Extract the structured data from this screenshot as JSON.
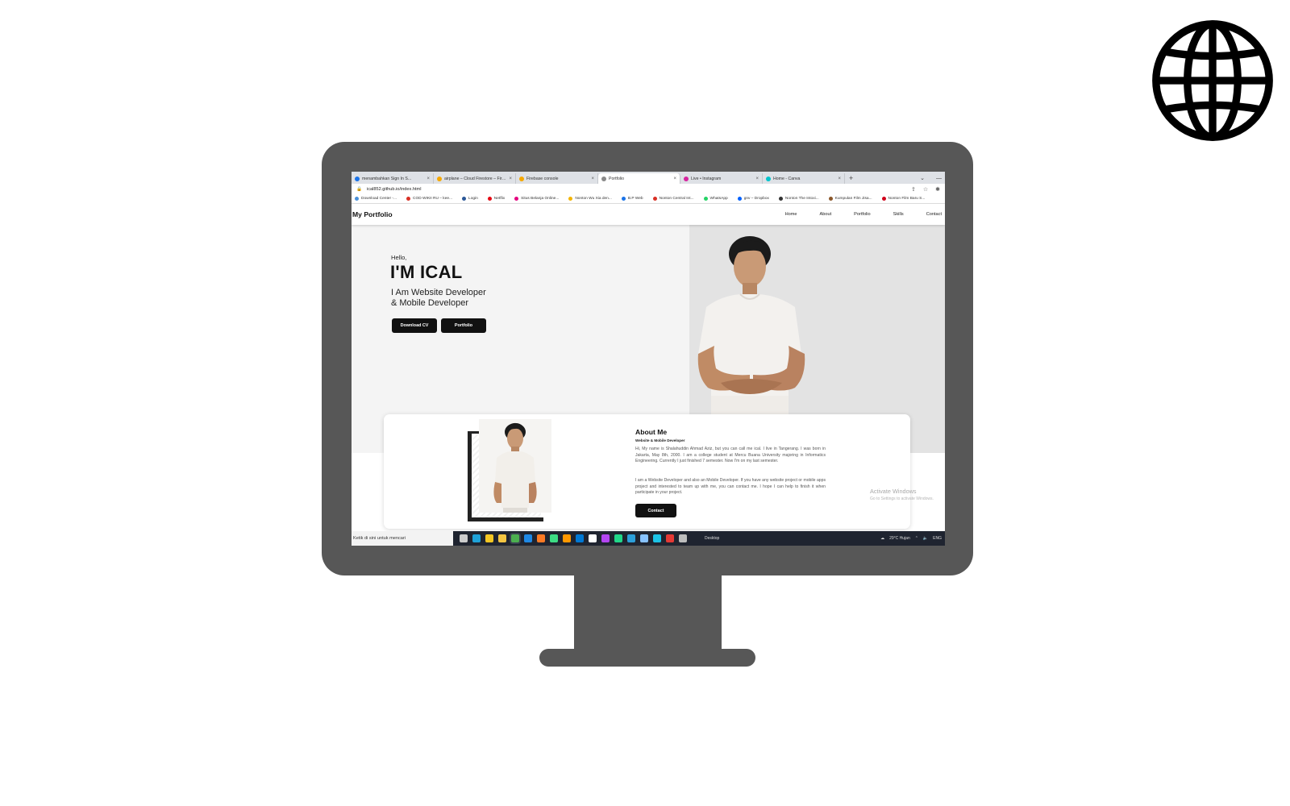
{
  "browser": {
    "tabs": [
      {
        "label": "menambahkan Sign In S...",
        "color": "#1a73e8",
        "active": false
      },
      {
        "label": "airplane – Cloud Firestore – Fire...",
        "color": "#f6a800",
        "active": false
      },
      {
        "label": "Firebase console",
        "color": "#f6a800",
        "active": false
      },
      {
        "label": "Portfolio",
        "color": "#8a8a8a",
        "active": true
      },
      {
        "label": "Live • Instagram",
        "color": "#d6249f",
        "active": false
      },
      {
        "label": "Home - Canva",
        "color": "#00c4cc",
        "active": false
      }
    ],
    "new_tab": "+",
    "url": "ical852.github.io/index.html",
    "bookmarks": [
      {
        "label": "Download Center -...",
        "color": "#4a90d9"
      },
      {
        "label": "COD WIKII RU – kee...",
        "color": "#d93025"
      },
      {
        "label": "Login",
        "color": "#2b5797"
      },
      {
        "label": "Netflix",
        "color": "#e50914"
      },
      {
        "label": "Situs Belanja Online...",
        "color": "#e4007f"
      },
      {
        "label": "Nonton Wu Xia den...",
        "color": "#f4b400"
      },
      {
        "label": "B.P Web",
        "color": "#1a73e8"
      },
      {
        "label": "Nonton Central Int...",
        "color": "#d93025"
      },
      {
        "label": "WhatsApp",
        "color": "#25d366"
      },
      {
        "label": "gnv – Dropbox",
        "color": "#0061fe"
      },
      {
        "label": "Nonton The Intoxi...",
        "color": "#333333"
      },
      {
        "label": "Kumpulan Film Jisa...",
        "color": "#8b572a"
      },
      {
        "label": "Nonton Film Baru S...",
        "color": "#d0021b"
      }
    ]
  },
  "site": {
    "brand": "My Portfolio",
    "nav": [
      "Home",
      "About",
      "Portfolio",
      "Skills",
      "Contact"
    ],
    "hero": {
      "hello": "Hello,",
      "name": "I'M ICAL",
      "role_line1": "I Am Website Developer",
      "role_line2": "& Mobile Developer",
      "btn_cv": "Download CV",
      "btn_portfolio": "Portfolio"
    },
    "about": {
      "title": "About Me",
      "subtitle": "Website & Mobile Developer",
      "p1": "Hi, My name is Shalahuddin Ahmad Aziz, but you can call me ical. I live in Tangerang. I was born in Jakarta, May 8th, 2000. I am a college student at Mercu Buana University majoring in Informatics Engineering. Currently I just finished 7 semester. Now I'm on my last semester.",
      "p2": "I am a Website Developer and also an Mobile Developer. If you have any website project or mobile apps project and interested to team up with me, you can contact me. I hope I can help to finish it when participate in your project.",
      "btn_contact": "Contact"
    }
  },
  "os": {
    "activate_title": "Activate Windows",
    "activate_sub": "Go to Settings to activate Windows.",
    "search_placeholder": "Ketik di sini untuk mencari",
    "desktop_label": "Desktop",
    "weather": "29°C  Hujan",
    "lang": "ENG",
    "taskbar_icons": [
      {
        "name": "task-view-icon",
        "color": "#cccccc"
      },
      {
        "name": "edge-icon",
        "color": "#1fa2d8"
      },
      {
        "name": "store-icon",
        "color": "#f3c623"
      },
      {
        "name": "file-explorer-icon",
        "color": "#f4c542"
      },
      {
        "name": "chrome-icon",
        "color": "#4caf50"
      },
      {
        "name": "mail-icon",
        "color": "#1e88e5"
      },
      {
        "name": "xampp-icon",
        "color": "#fb7a24"
      },
      {
        "name": "android-studio-icon",
        "color": "#3ddc84"
      },
      {
        "name": "sublime-icon",
        "color": "#ff9800"
      },
      {
        "name": "vscode-icon",
        "color": "#0078d4"
      },
      {
        "name": "app-icon",
        "color": "#ffffff"
      },
      {
        "name": "phpstorm-icon",
        "color": "#b345f1"
      },
      {
        "name": "app2-icon",
        "color": "#21d789"
      },
      {
        "name": "app3-icon",
        "color": "#2c9fd9"
      },
      {
        "name": "app4-icon",
        "color": "#87c2ff"
      },
      {
        "name": "app5-icon",
        "color": "#1cc3e6"
      },
      {
        "name": "app6-icon",
        "color": "#e53935"
      },
      {
        "name": "app7-icon",
        "color": "#bdbdbd"
      }
    ]
  }
}
